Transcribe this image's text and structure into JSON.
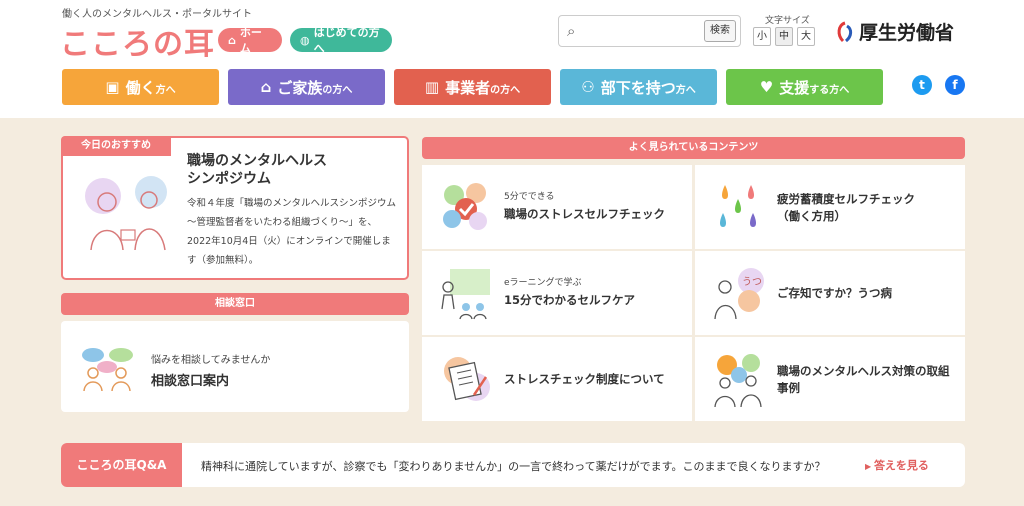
{
  "header": {
    "tagline": "働く人のメンタルヘルス・ポータルサイト",
    "logo": "こころの耳",
    "home_label": "ホーム",
    "first_time_label": "はじめての方へ",
    "search_placeholder": "",
    "search_button": "検索",
    "font_size_label": "文字サイズ",
    "font_sizes": [
      "小",
      "中",
      "大"
    ],
    "ministry": "厚生労働省"
  },
  "nav": [
    {
      "main": "働く",
      "suffix": "方へ",
      "color": "#f6a53a"
    },
    {
      "main": "ご家族",
      "suffix": "の方へ",
      "color": "#7a6ac9"
    },
    {
      "main": "事業者",
      "suffix": "の方へ",
      "color": "#e2614f"
    },
    {
      "main": "部下を持つ",
      "suffix": "方へ",
      "color": "#5ab7d8"
    },
    {
      "main": "支援",
      "suffix": "する方へ",
      "color": "#6cc54a"
    }
  ],
  "social": {
    "twitter": "t",
    "facebook": "f"
  },
  "recommend": {
    "tag": "今日のおすすめ",
    "title": "職場のメンタルヘルス\nシンポジウム",
    "body": "令和４年度「職場のメンタルヘルスシンポジウム～管理監督者をいたわる組織づくり～」を、2022年10月4日（火）にオンラインで開催します（参加無料）。"
  },
  "consult": {
    "header": "相談窓口",
    "sub": "悩みを相談してみませんか",
    "main": "相談窓口案内"
  },
  "popular": {
    "header": "よく見られているコンテンツ",
    "items": [
      {
        "small": "5分でできる",
        "label": "職場のストレスセルフチェック"
      },
      {
        "small": "",
        "label": "疲労蓄積度セルフチェック\n（働く方用）"
      },
      {
        "small": "eラーニングで学ぶ",
        "label": "15分でわかるセルフケア"
      },
      {
        "small": "",
        "label": "ご存知ですか？うつ病"
      },
      {
        "small": "",
        "label": "ストレスチェック制度について"
      },
      {
        "small": "",
        "label": "職場のメンタルヘルス対策の取組事例"
      }
    ]
  },
  "qa": {
    "tag": "こころの耳Q&A",
    "question": "精神科に通院していますが、診察でも「変わりありませんか」の一言で終わって薬だけがでます。このままで良くなりますか？",
    "link": "答えを見る"
  },
  "colors": {
    "accent": "#f07a7a",
    "background": "#f4ecdf",
    "teal": "#3fb89a"
  }
}
